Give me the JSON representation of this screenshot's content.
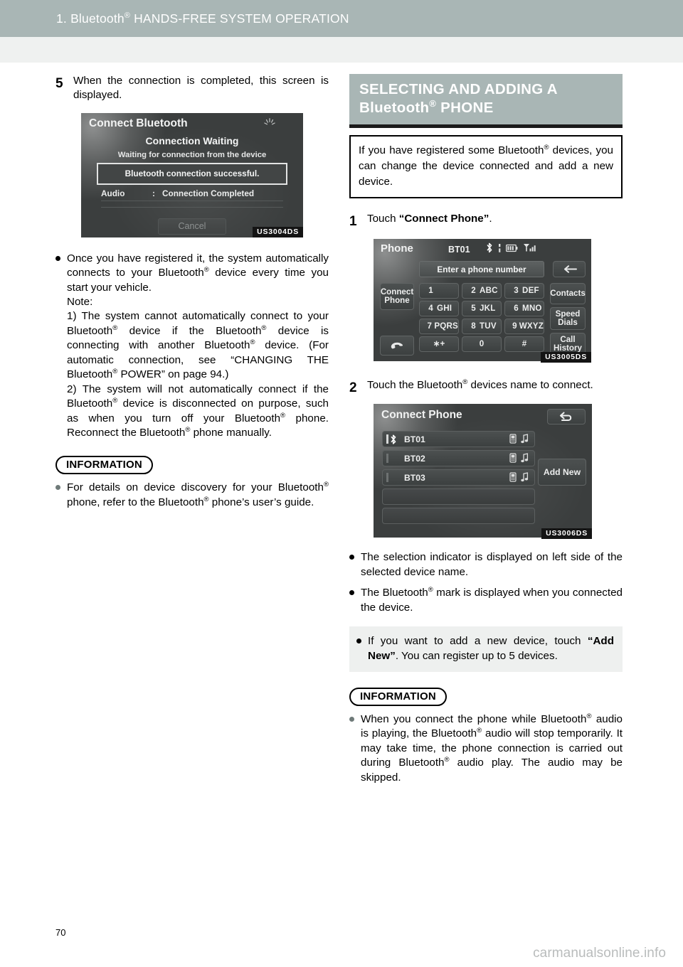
{
  "header": {
    "chapter": "1.",
    "title_pre": "Bluetooth",
    "title_sup": "®",
    "title_post": " HANDS-FREE SYSTEM OPERATION"
  },
  "footer": {
    "page_number": "70",
    "watermark": "carmanualsonline.info"
  },
  "left_column": {
    "step5": {
      "number": "5",
      "text": "When the connection is completed, this screen is displayed."
    },
    "figure_connect_bluetooth": {
      "id_label": "US3004DS",
      "screen_title": "Connect Bluetooth",
      "heading": "Connection Waiting",
      "subtext": "Waiting for connection from the device",
      "message": "Bluetooth connection successful.",
      "row_label": "Audio",
      "row_colon": ":",
      "row_value": "Connection Completed",
      "cancel_label": "Cancel"
    },
    "bullet_auto_connect": {
      "line1_a": "Once you have registered it, the system automatically connects to your Bluetooth",
      "line1_b": " device every time you start your vehicle.",
      "note_label": "Note:",
      "note1_a": "1) The system cannot automatically connect to your Bluetooth",
      "note1_b": " device if the Bluetooth",
      "note1_c": " device is connecting with another Bluetooth",
      "note1_d": " device. (For automatic connection, see “CHANGING THE Bluetooth",
      "note1_e": " POWER” on page 94.)",
      "note2_a": "2) The system will not automatically connect if the Bluetooth",
      "note2_b": " device is disconnected on purpose, such as when you turn off your Bluetooth",
      "note2_c": " phone. Reconnect the Bluetooth",
      "note2_d": " phone manually."
    },
    "information": {
      "label": "INFORMATION",
      "bullet_a": "For details on device discovery for your Bluetooth",
      "bullet_b": " phone, refer to the Bluetooth",
      "bullet_c": " phone’s user’s guide."
    }
  },
  "right_column": {
    "section_title": {
      "line1": "SELECTING AND ADDING A",
      "line2_pre": "Bluetooth",
      "line2_sup": "®",
      "line2_post": " PHONE"
    },
    "intro_box": {
      "text_a": "If you have registered some Bluetooth",
      "text_b": " devices, you can change the device connected and add a new device."
    },
    "step1": {
      "number": "1",
      "text_pre": "Touch ",
      "text_bold": "“Connect Phone”",
      "text_post": "."
    },
    "figure_phone": {
      "id_label": "US3005DS",
      "screen_title": "Phone",
      "device_name": "BT01",
      "input_placeholder": "Enter a phone number",
      "icons": {
        "bluetooth": "bluetooth-icon",
        "battery": "battery-icon",
        "signal": "signal-bars-icon",
        "backspace": "backspace-arrow-icon",
        "call": "handset-icon"
      },
      "side_buttons_left": [
        "Connect\nPhone"
      ],
      "connect_phone_line1": "Connect",
      "connect_phone_line2": "Phone",
      "side_buttons_right": [
        {
          "line1": "Contacts",
          "line2": ""
        },
        {
          "line1": "Speed",
          "line2": "Dials"
        },
        {
          "line1": "Call",
          "line2": "History"
        }
      ],
      "keypad": [
        {
          "digit": "1",
          "letters": ""
        },
        {
          "digit": "2",
          "letters": "ABC"
        },
        {
          "digit": "3",
          "letters": "DEF"
        },
        {
          "digit": "4",
          "letters": "GHI"
        },
        {
          "digit": "5",
          "letters": "JKL"
        },
        {
          "digit": "6",
          "letters": "MNO"
        },
        {
          "digit": "7",
          "letters": "PQRS"
        },
        {
          "digit": "8",
          "letters": "TUV"
        },
        {
          "digit": "9",
          "letters": "WXYZ"
        }
      ],
      "keypad_bottom": [
        "∗+",
        "0",
        "#"
      ]
    },
    "step2": {
      "number": "2",
      "text_a": "Touch the Bluetooth",
      "text_b": " devices name to connect."
    },
    "figure_connect_phone": {
      "id_label": "US3006DS",
      "screen_title": "Connect Phone",
      "back_icon": "back-arrow-icon",
      "devices": [
        {
          "name": "BT01",
          "selected": true,
          "bluetooth_mark": true
        },
        {
          "name": "BT02",
          "selected": false,
          "bluetooth_mark": false
        },
        {
          "name": "BT03",
          "selected": false,
          "bluetooth_mark": false
        },
        {
          "name": "",
          "selected": false,
          "bluetooth_mark": false
        },
        {
          "name": "",
          "selected": false,
          "bluetooth_mark": false
        }
      ],
      "add_new_label": "Add New",
      "row_icons": [
        "phone-handset-icon",
        "music-note-icon"
      ]
    },
    "bullets": [
      {
        "text": "The selection indicator is displayed on left side of the selected device name."
      },
      {
        "text_a": "The Bluetooth",
        "text_b": " mark is displayed when you connected the device."
      }
    ],
    "tip_panel": {
      "text_pre": "If you want to add a new device, touch ",
      "text_bold": "“Add New”",
      "text_post": ". You can register up to 5 devices."
    },
    "information": {
      "label": "INFORMATION",
      "text_a": "When you connect the phone while Bluetooth",
      "text_b": " audio is playing, the Bluetooth",
      "text_c": " audio will stop temporarily. It may take time, the phone connection is carried out during Bluetooth",
      "text_d": " audio play. The audio may be skipped."
    }
  },
  "colors": {
    "header_band": "#a9b6b5",
    "subheader_band": "#eff1f0",
    "tip_panel": "#eef0ef",
    "screen_bg": "#3b3e3e"
  }
}
